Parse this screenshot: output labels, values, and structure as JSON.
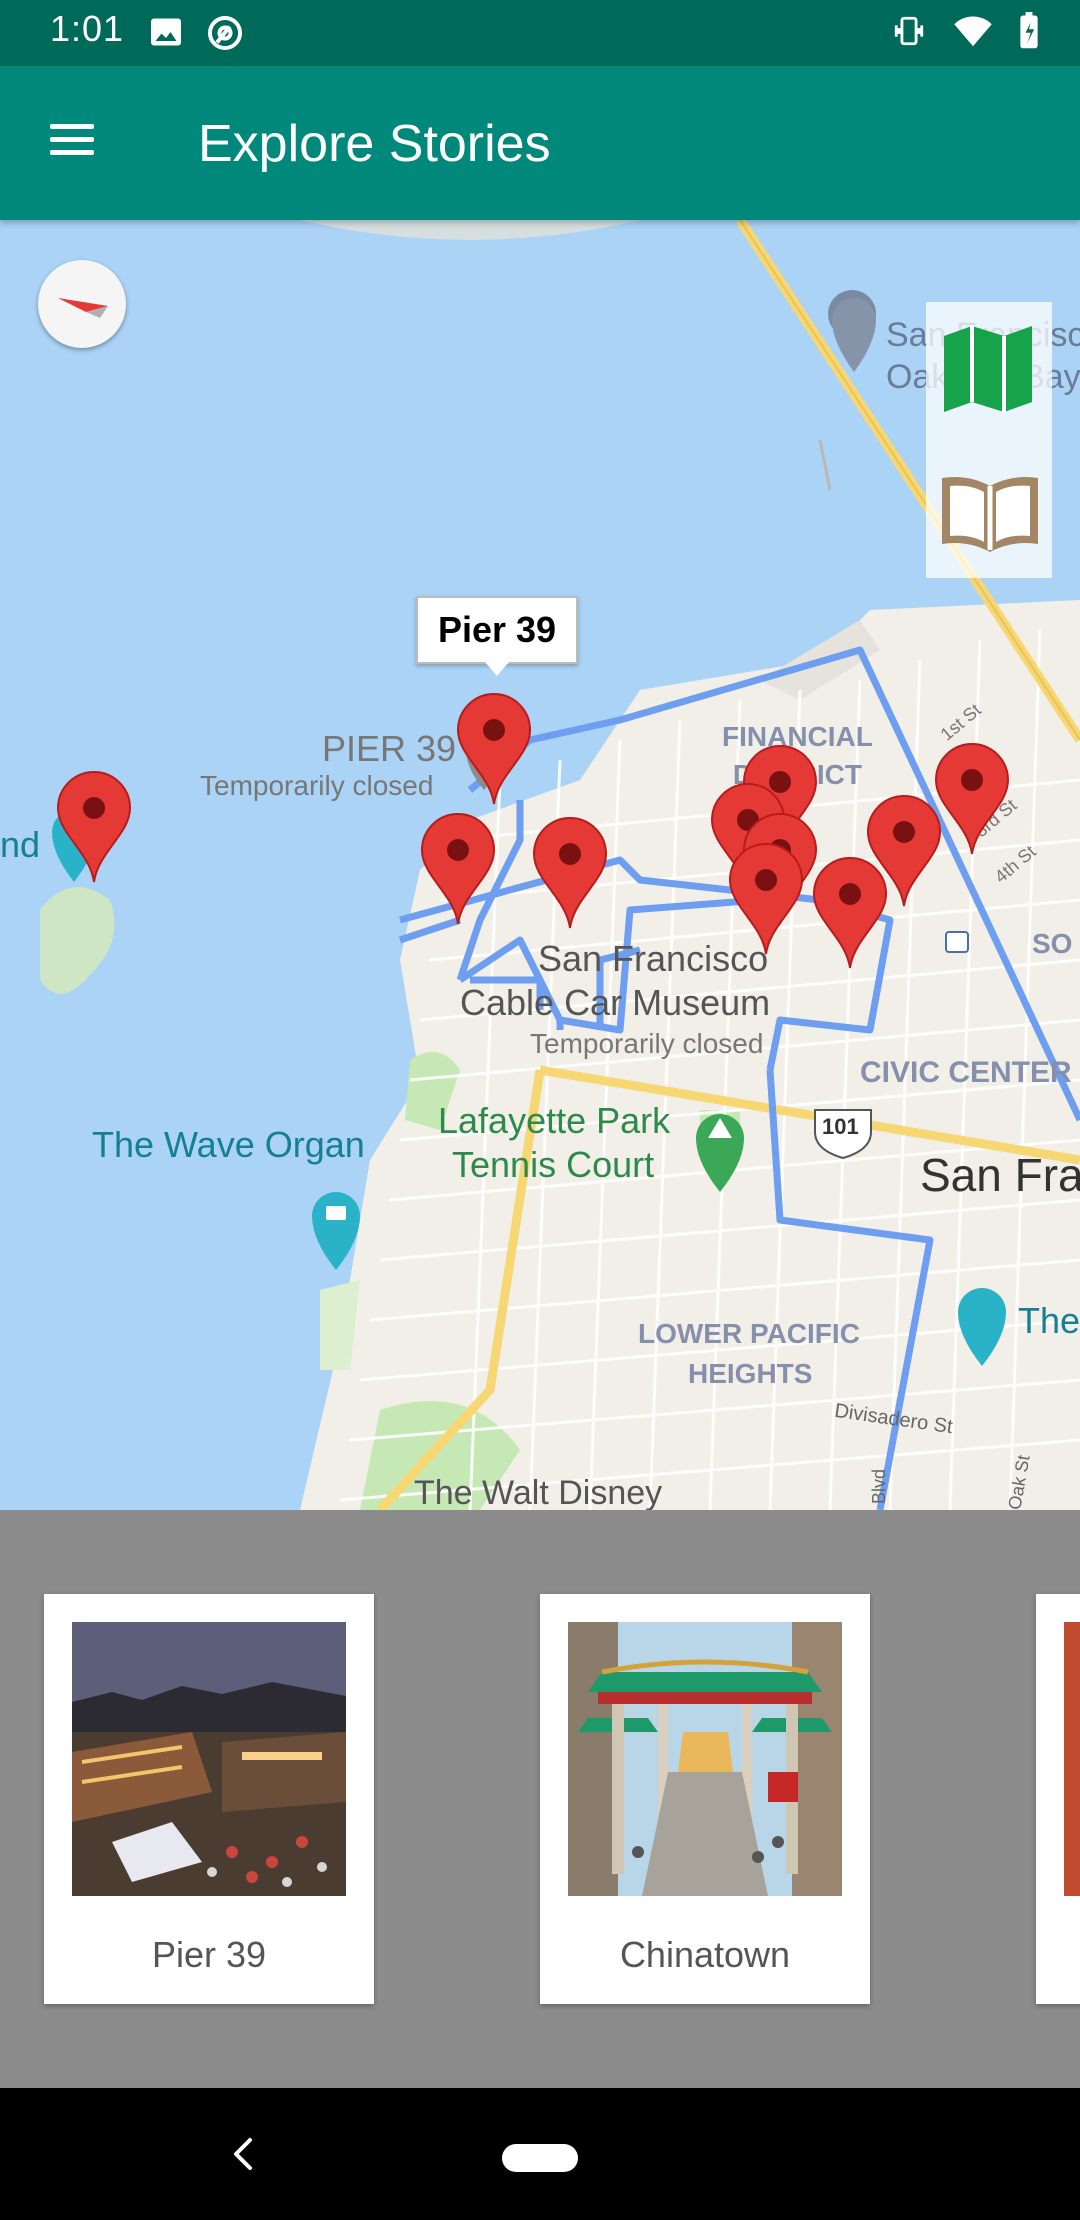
{
  "status_bar": {
    "time": "1:01"
  },
  "app_bar": {
    "title": "Explore Stories"
  },
  "map": {
    "callout": "Pier 39",
    "labels": {
      "pier39": "PIER 39",
      "pier39_status": "Temporarily closed",
      "island_partial": "nd",
      "bay_bridge_1": "San Francisco",
      "bay_bridge_2": "Oakland Bay",
      "financial_district": "FINANCIAL\nDISTRICT",
      "first_st": "1st St",
      "third_st": "3rd St",
      "fourth_st": "4th St",
      "soma_partial": "SO",
      "cable_car_1": "San Francisco",
      "cable_car_2": "Cable Car Museum",
      "cable_car_status": "Temporarily closed",
      "civic_center": "CIVIC CENTER",
      "highway": "101",
      "wave_organ": "The Wave Organ",
      "lafayette_1": "Lafayette Park",
      "lafayette_2": "Tennis Court",
      "san_fran_partial": "San Fra",
      "the_partial": "The",
      "lower_pacific_1": "LOWER PACIFIC",
      "lower_pacific_2": "HEIGHTS",
      "divisadero": "Divisadero St",
      "blvd": "Blvd",
      "oak_st": "Oak St",
      "walt_disney": "The Walt Disney"
    },
    "view_toggle": {
      "map_icon": "map-icon",
      "book_icon": "book-icon"
    },
    "colors": {
      "water": "#aad3f5",
      "land": "#f2efe9",
      "route": "#6d9ef0",
      "pin": "#e53935",
      "highway": "#f7d774",
      "park": "#c6e8b4"
    }
  },
  "cards": [
    {
      "label": "Pier 39"
    },
    {
      "label": "Chinatown"
    }
  ]
}
